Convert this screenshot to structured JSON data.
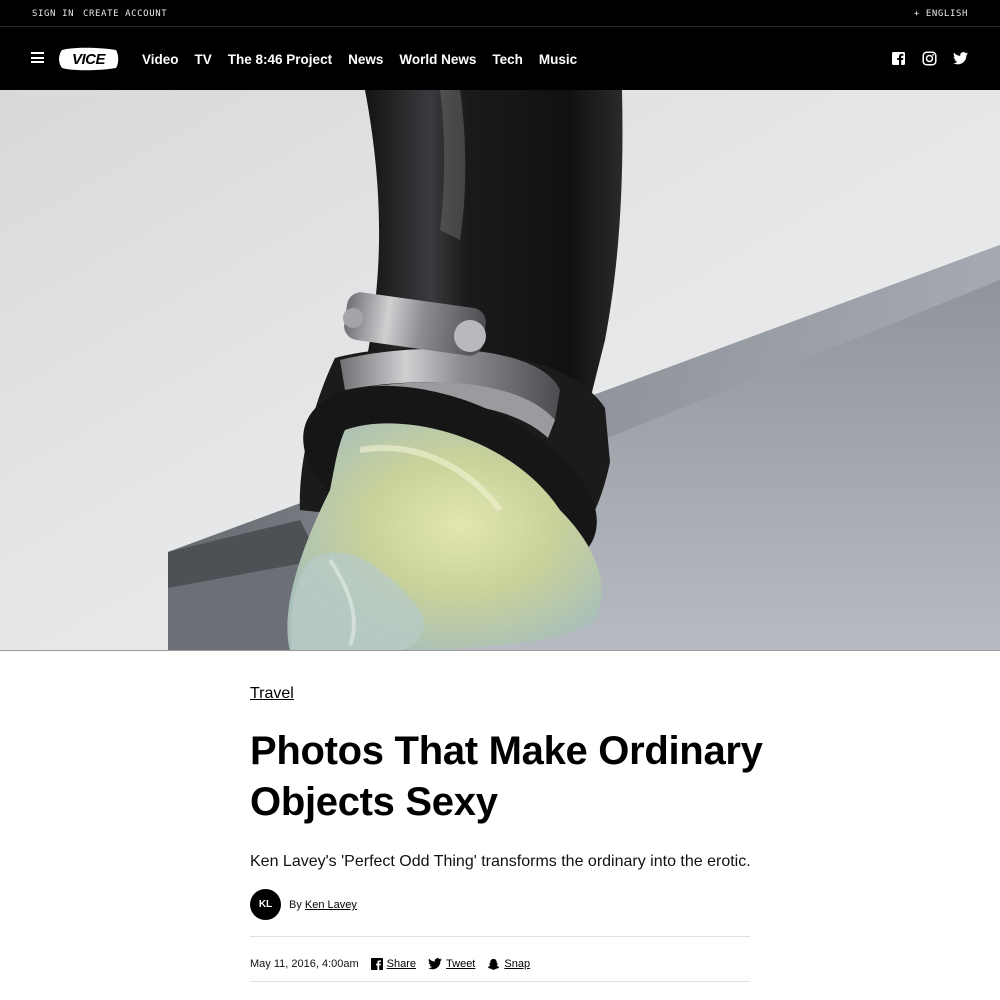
{
  "utility_bar": {
    "sign_in": "SIGN IN",
    "create_account": "CREATE ACCOUNT",
    "language": "+ ENGLISH"
  },
  "nav": {
    "logo_alt": "VICE",
    "items": [
      "Video",
      "TV",
      "The 8:46 Project",
      "News",
      "World News",
      "Tech",
      "Music"
    ],
    "social_icons": [
      "facebook-icon",
      "instagram-icon",
      "twitter-icon"
    ]
  },
  "hero": {
    "icon": "photo-black-pipe-with-clamp-oozing-gel-onto-gray-ledge"
  },
  "article": {
    "category": "Travel",
    "headline": "Photos That Make Ordinary Objects Sexy",
    "dek": "Ken Lavey's 'Perfect Odd Thing' transforms the ordinary into the erotic.",
    "author_initials": "KL",
    "byline_prefix": "By",
    "author": "Ken Lavey",
    "date": "May 11, 2016, 4:00am",
    "share": {
      "facebook": "Share",
      "twitter": "Tweet",
      "snapchat": "Snap"
    }
  },
  "colors": {
    "nav_bg": "#000000",
    "nav_text": "#ffffff",
    "text": "#000000",
    "rule": "#e2e2e2"
  }
}
